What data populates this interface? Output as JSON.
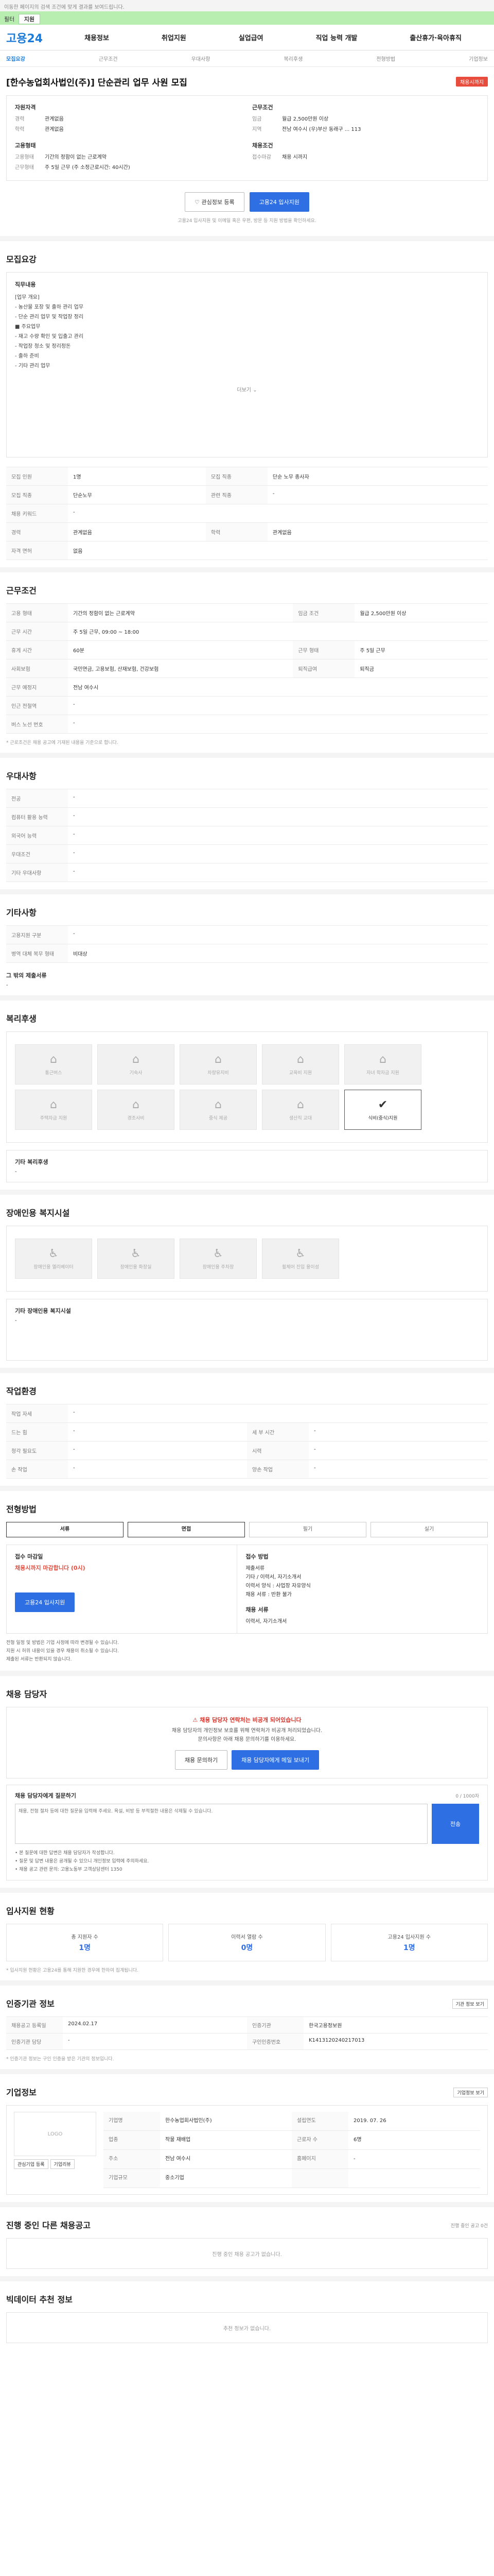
{
  "top_notice": {
    "text": "이동한 페이지의 검색 조건에 맞게 결과를 보여드립니다.",
    "link": ""
  },
  "filter_bar": {
    "label": "필터",
    "chip": "지원"
  },
  "header": {
    "logo": "고용24",
    "nav": [
      "채용정보",
      "취업지원",
      "실업급여",
      "직업 능력 개발",
      "출산휴가·육아휴직"
    ]
  },
  "subtabs": [
    "모집요강",
    "근무조건",
    "우대사항",
    "복리후생",
    "전형방법",
    "기업정보"
  ],
  "job": {
    "title": "[한수농업회사법인(주)] 단순관리 업무 사원 모집",
    "state_badge": "채용시까지",
    "recruit_heading": "자원자격",
    "apply_heading": "근무조건",
    "edu_label": "경력",
    "edu_value": "관계없음",
    "career_label": "학력",
    "career_value": "관계없음",
    "salary_label": "임금",
    "salary_value": "월급 2,500만원 이상",
    "area_label": "지역",
    "area_value": "전남 여수시 (우)부산 동래구 ... 113",
    "employ_heading": "고용형태",
    "employ_type_label": "고용형태",
    "employ_type_value": "기간의 정함이 없는 근로계약",
    "work_form_label": "근무형태",
    "work_form_value": "주 5일 근무 (주 소정근로시간: 40시간)",
    "deadline_heading": "채용조건",
    "deadline_label": "접수마감",
    "deadline_value": "채용 시까지"
  },
  "actions": {
    "scrap": "관심정보 등록",
    "apply": "고용24 입사지원",
    "note": "고용24 입사지원 및 이메일 혹은 우편, 방문 등 지원 방법을 확인하세요."
  },
  "summary": {
    "title": "모집요강",
    "duty_heading": "직무내용",
    "lines": [
      "[업무 개요]",
      "- 농산물 포장 및 출하 관리 업무",
      "- 단순 관리 업무 및 작업장 정리",
      "",
      "■ 주요업무",
      "- 재고 수량 확인 및 입출고 관리",
      "- 작업장 청소 및 정리정돈",
      "- 출하 준비",
      "- 기타 관리 업무"
    ],
    "more": "더보기"
  },
  "recruit_table": [
    {
      "k": "모집 인원",
      "v": "1명",
      "k2": "모집 직종",
      "v2": "단순 노무 종사자"
    },
    {
      "k": "모집 직종",
      "v": "단순노무",
      "k2": "관련 직종",
      "v2": "-"
    },
    {
      "k": "채용 키워드",
      "v": "-",
      "k2": "",
      "v2": ""
    },
    {
      "k": "경력",
      "v": "관계없음",
      "k2": "학력",
      "v2": "관계없음"
    },
    {
      "k": "자격 면허",
      "v": "없음",
      "k2": "",
      "v2": ""
    }
  ],
  "condition": {
    "title": "근무조건",
    "rows": [
      {
        "k": "고용 형태",
        "v": "기간의 정함이 없는 근로계약",
        "k2": "임금 조건",
        "v2": "월급 2,500만원 이상"
      },
      {
        "k": "근무 시간",
        "v": "주 5일 근무, 09:00 ~ 18:00",
        "k2": "",
        "v2": ""
      },
      {
        "k": "휴게 시간",
        "v": "60분",
        "k2": "근무 형태",
        "v2": "주 5일 근무"
      },
      {
        "k": "사회보험",
        "v": "국민연금, 고용보험, 산재보험, 건강보험",
        "k2": "퇴직급여",
        "v2": "퇴직금"
      },
      {
        "k": "근무 예정지",
        "v": "전남 여수시",
        "k2": "",
        "v2": ""
      },
      {
        "k": "인근 전철역",
        "v": "-",
        "k2": "",
        "v2": ""
      },
      {
        "k": "버스 노선 번호",
        "v": "-",
        "k2": "",
        "v2": ""
      }
    ],
    "map_btn": "지도 보기",
    "footnote": "* 근로조건은 채용 공고에 기재된 내용을 기준으로 합니다."
  },
  "preference": {
    "title": "우대사항",
    "rows": [
      {
        "k": "전공",
        "v": "-"
      },
      {
        "k": "컴퓨터 활용 능력",
        "v": "-"
      },
      {
        "k": "외국어 능력",
        "v": "-"
      },
      {
        "k": "우대조건",
        "v": "-"
      },
      {
        "k": "기타 우대사항",
        "v": "-"
      }
    ]
  },
  "etc": {
    "title": "기타사항",
    "rows": [
      {
        "k": "고용지원 구분",
        "v": "-"
      },
      {
        "k": "병역 대체 복무 형태",
        "v": "비대상"
      }
    ],
    "extra_label": "그 밖의 제출서류",
    "extra_value": "-"
  },
  "welfare": {
    "title": "복리후생",
    "tiles": [
      {
        "name": "통근버스",
        "glyph": "⌂",
        "on": false
      },
      {
        "name": "기숙사",
        "glyph": "⌂",
        "on": false
      },
      {
        "name": "차량유지비",
        "glyph": "⌂",
        "on": false
      },
      {
        "name": "교육비 지원",
        "glyph": "⌂",
        "on": false
      },
      {
        "name": "자녀 학자금 지원",
        "glyph": "⌂",
        "on": false
      },
      {
        "name": "주택자금 지원",
        "glyph": "⌂",
        "on": false
      },
      {
        "name": "경조사비",
        "glyph": "⌂",
        "on": false
      },
      {
        "name": "중식 제공",
        "glyph": "⌂",
        "on": false
      },
      {
        "name": "생산직 교대",
        "glyph": "⌂",
        "on": false
      },
      {
        "name": "식비(중식)지원",
        "glyph": "✔",
        "on": true
      }
    ],
    "other_label": "기타 복리후생",
    "other_value": "-"
  },
  "disability": {
    "title": "장애인용 복지시설",
    "tiles": [
      {
        "name": "장애인용 엘리베이터",
        "glyph": "♿"
      },
      {
        "name": "장애인용 화장실",
        "glyph": "♿"
      },
      {
        "name": "장애인용 주차장",
        "glyph": "♿"
      },
      {
        "name": "휠체어 진입 용이성",
        "glyph": "♿"
      }
    ],
    "other_label": "기타 장애인용 복지시설",
    "other_value": "-"
  },
  "work_env": {
    "title": "작업환경",
    "rows": [
      {
        "k": "작업 자세",
        "v": "-",
        "k2": "",
        "v2": ""
      },
      {
        "k": "드는 힘",
        "v": "-",
        "k2": "세 부 시간",
        "v2": "-"
      },
      {
        "k": "청각 필요도",
        "v": "-",
        "k2": "시력",
        "v2": "-"
      },
      {
        "k": "손 작업",
        "v": "-",
        "k2": "양손 작업",
        "v2": "-"
      }
    ]
  },
  "process": {
    "title": "전형방법",
    "steps": [
      "서류",
      "면접",
      "필기",
      "실기"
    ],
    "active": [
      true,
      true,
      false,
      false
    ],
    "apply_method_label": "접수 마감일",
    "deadline": "채용시까지 마감합니다 (0시)",
    "apply_btn": "고용24 입사지원",
    "doc_label": "접수 방법",
    "doc_lines": [
      "제출서류",
      "기타 / 이력서, 자기소개서",
      "이력서 양식 : 사업장 자유양식",
      "채용 서류 : 반환 불가"
    ],
    "contact_label": "채용 서류",
    "contact_value": "이력서, 자기소개서",
    "notes": [
      "전형 일정 및 방법은 기업 사정에 따라 변경될 수 있습니다.",
      "지원 시 허위 내용이 있을 경우 채용이 취소될 수 있습니다.",
      "제출된 서류는 반환되지 않습니다."
    ]
  },
  "contact": {
    "title": "채용 담당자",
    "warn": "채용 담당자 연락처는 비공개 되어있습니다",
    "line1": "채용 담당자의 개인정보 보호를 위해 연락처가 비공개 처리되었습니다.",
    "line2": "문의사항은 아래 채용 문의하기를 이용하세요.",
    "btn1": "채용 문의하기",
    "btn2": "채용 담당자에게 메일 보내기"
  },
  "inquiry": {
    "label": "채용 담당자에게 질문하기",
    "right": "0 / 1000자",
    "placeholder": "채용, 전형 절차 등에 대한 질문을 입력해 주세요. 욕설, 비방 등 부적절한 내용은 삭제될 수 있습니다.",
    "send": "전송",
    "bullets": [
      "• 본 질문에 대한 답변은 채용 담당자가 작성합니다.",
      "• 질문 및 답변 내용은 공개될 수 있으니 개인정보 입력에 주의하세요.",
      "• 채용 공고 관련 문의: 고용노동부 고객상담센터 1350"
    ]
  },
  "applicants": {
    "title": "입사지원 현황",
    "stats": [
      {
        "label": "총 지원자 수",
        "num": "1명"
      },
      {
        "label": "이력서 열람 수",
        "num": "0명"
      },
      {
        "label": "고용24 입사지원 수",
        "num": "1명"
      }
    ],
    "note": "* 입사지원 현황은 고용24를 통해 지원한 경우에 한하여 집계됩니다."
  },
  "info": {
    "title": "인증기관 정보",
    "btn": "기관 정보 보기",
    "rows": [
      {
        "k": "채용공고 등록일",
        "v": "2024.02.17",
        "k2": "인증기관",
        "v2": "한국고용정보원"
      },
      {
        "k": "인증기관 담당",
        "v": "-",
        "k2": "구인인증번호",
        "v2": "K1413120240217013"
      }
    ],
    "note": "* 인증기관 정보는 구인 인증을 받은 기관의 정보입니다."
  },
  "company": {
    "title": "기업정보",
    "btn": "기업정보 보기",
    "logo_text": "LOGO",
    "rows": [
      {
        "k": "기업명",
        "v": "한수농업회사법인(주)",
        "k2": "설립연도",
        "v2": "2019. 07. 26"
      },
      {
        "k": "업종",
        "v": "작물 재배업",
        "k2": "근로자 수",
        "v2": "6명"
      },
      {
        "k": "주소",
        "v": "전남 여수시",
        "k2": "홈페이지",
        "v2": "-"
      },
      {
        "k": "기업규모",
        "v": "중소기업",
        "k2": "",
        "v2": ""
      }
    ],
    "btn_a": "관심기업 등록",
    "btn_b": "기업리뷰"
  },
  "other_jobs": {
    "title": "진행 중인 다른 채용공고",
    "right": "진행 중인 공고 0건",
    "empty": "진행 중인 채용 공고가 없습니다."
  },
  "similar_jobs": {
    "title": "빅데이터 추천 정보",
    "empty": "추천 정보가 없습니다."
  }
}
